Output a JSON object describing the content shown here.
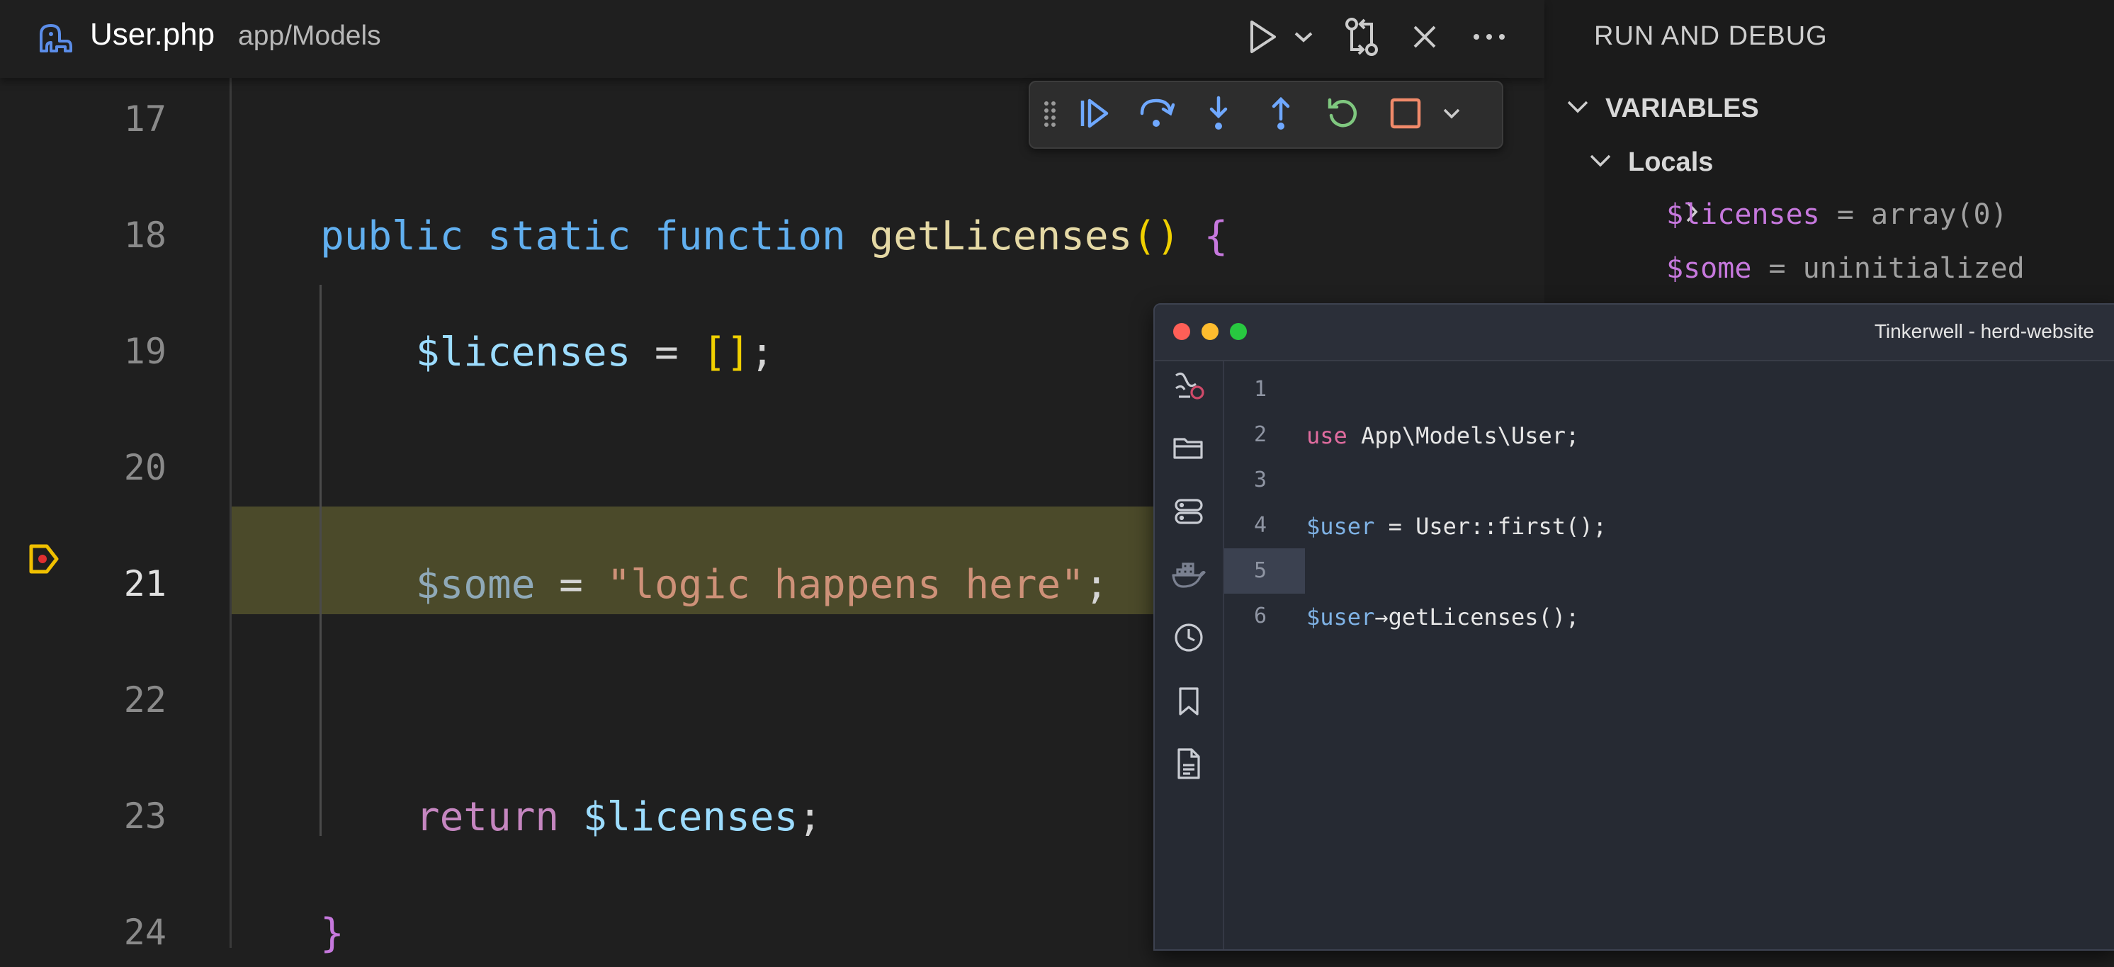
{
  "header": {
    "file_name": "User.php",
    "file_path": "app/Models"
  },
  "editor": {
    "lines": [
      {
        "num": "17",
        "tokens": []
      },
      {
        "num": "18",
        "tokens": [
          {
            "t": "public",
            "c": "tk-kw"
          },
          {
            "t": " "
          },
          {
            "t": "static",
            "c": "tk-kw"
          },
          {
            "t": " "
          },
          {
            "t": "function",
            "c": "tk-kw"
          },
          {
            "t": " "
          },
          {
            "t": "getLicenses",
            "c": "tk-fn"
          },
          {
            "t": "()",
            "c": "tk-paren"
          },
          {
            "t": " "
          },
          {
            "t": "{",
            "c": "tk-brace"
          }
        ]
      },
      {
        "num": "19",
        "tokens": [
          {
            "t": "    "
          },
          {
            "t": "$licenses",
            "c": "tk-var"
          },
          {
            "t": " = ",
            "c": "tk-op"
          },
          {
            "t": "[]",
            "c": "tk-bracket"
          },
          {
            "t": ";",
            "c": "tk-op"
          }
        ]
      },
      {
        "num": "20",
        "tokens": []
      },
      {
        "num": "21",
        "active": true,
        "tokens": [
          {
            "t": "    "
          },
          {
            "t": "$some",
            "c": "tk-var-dim"
          },
          {
            "t": " = ",
            "c": "tk-op"
          },
          {
            "t": "\"logic happens here\"",
            "c": "tk-str"
          },
          {
            "t": ";",
            "c": "tk-op"
          }
        ]
      },
      {
        "num": "22",
        "tokens": []
      },
      {
        "num": "23",
        "tokens": [
          {
            "t": "    "
          },
          {
            "t": "return",
            "c": "tk-ret"
          },
          {
            "t": " "
          },
          {
            "t": "$licenses",
            "c": "tk-var"
          },
          {
            "t": ";",
            "c": "tk-op"
          }
        ]
      },
      {
        "num": "24",
        "tokens": [
          {
            "t": "}",
            "c": "tk-brace"
          }
        ]
      }
    ]
  },
  "debug_panel": {
    "title": "RUN AND DEBUG",
    "variables_title": "VARIABLES",
    "locals_title": "Locals",
    "variables": [
      {
        "name": "$licenses",
        "eq": " = ",
        "value": "array(0)",
        "expandable": true
      },
      {
        "name": "$some",
        "eq": " = ",
        "value": "uninitialized",
        "expandable": false
      }
    ]
  },
  "tinkerwell": {
    "title": "Tinkerwell - herd-website",
    "active_line": "5",
    "lines": [
      {
        "num": "1",
        "tokens": []
      },
      {
        "num": "2",
        "tokens": [
          {
            "t": "use",
            "c": "tw-kw"
          },
          {
            "t": " App\\Models\\User;"
          }
        ]
      },
      {
        "num": "3",
        "tokens": []
      },
      {
        "num": "4",
        "tokens": [
          {
            "t": "$user",
            "c": "tw-var"
          },
          {
            "t": " = User::first();"
          }
        ]
      },
      {
        "num": "5",
        "tokens": []
      },
      {
        "num": "6",
        "tokens": [
          {
            "t": "$user",
            "c": "tw-var"
          },
          {
            "t": "→getLicenses();"
          }
        ]
      }
    ]
  },
  "colors": {
    "current_line": "#4b4a2a",
    "breakpoint": "#f0c000",
    "continue": "#6fa8ff",
    "restart": "#7fc77f",
    "stop": "#f08a6a"
  },
  "icons": {
    "header": [
      "php-elephant-icon",
      "run-icon",
      "chevron-down-icon",
      "compare-changes-icon",
      "close-icon",
      "more-actions-icon"
    ],
    "debug_toolbar": [
      "drag-handle-icon",
      "continue-icon",
      "step-over-icon",
      "step-into-icon",
      "step-out-icon",
      "restart-icon",
      "stop-icon",
      "chevron-down-icon"
    ],
    "tinkerwell_sidebar": [
      "debug-icon",
      "folder-icon",
      "database-icon",
      "docker-icon",
      "history-icon",
      "bookmark-icon",
      "document-icon"
    ]
  }
}
